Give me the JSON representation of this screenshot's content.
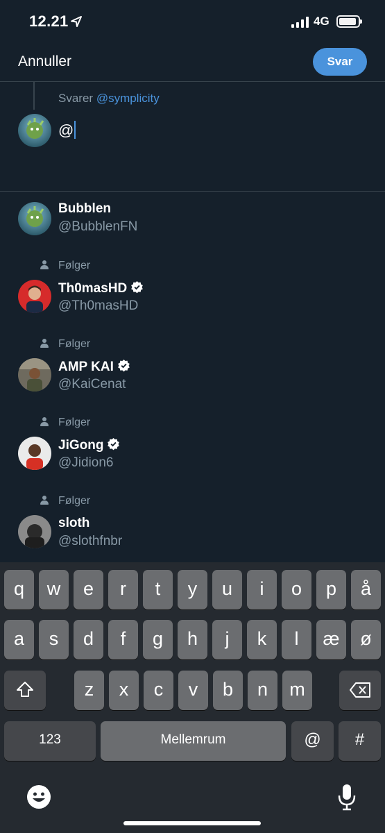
{
  "status_bar": {
    "time": "12.21",
    "network": "4G"
  },
  "header": {
    "cancel_label": "Annuller",
    "reply_label": "Svar"
  },
  "compose": {
    "replying_prefix": "Svarer",
    "replying_handle": "@symplicity",
    "text": "@"
  },
  "suggestions": [
    {
      "name": "Bubblen",
      "handle": "@BubblenFN",
      "follow_label": "",
      "verified": false
    },
    {
      "name": "Th0masHD",
      "handle": "@Th0masHD",
      "follow_label": "Følger",
      "verified": true
    },
    {
      "name": "AMP KAI",
      "handle": "@KaiCenat",
      "follow_label": "Følger",
      "verified": true
    },
    {
      "name": "JiGong",
      "handle": "@Jidion6",
      "follow_label": "Følger",
      "verified": true
    },
    {
      "name": "sloth",
      "handle": "@slothfnbr",
      "follow_label": "Følger",
      "verified": false
    }
  ],
  "keyboard": {
    "row1": [
      "q",
      "w",
      "e",
      "r",
      "t",
      "y",
      "u",
      "i",
      "o",
      "p",
      "å"
    ],
    "row2": [
      "a",
      "s",
      "d",
      "f",
      "g",
      "h",
      "j",
      "k",
      "l",
      "æ",
      "ø"
    ],
    "row3": [
      "z",
      "x",
      "c",
      "v",
      "b",
      "n",
      "m"
    ],
    "numbers_label": "123",
    "space_label": "Mellemrum",
    "at_label": "@",
    "hash_label": "#"
  },
  "colors": {
    "background": "#15202b",
    "accent": "#4a93dc",
    "muted": "#8899a6"
  }
}
